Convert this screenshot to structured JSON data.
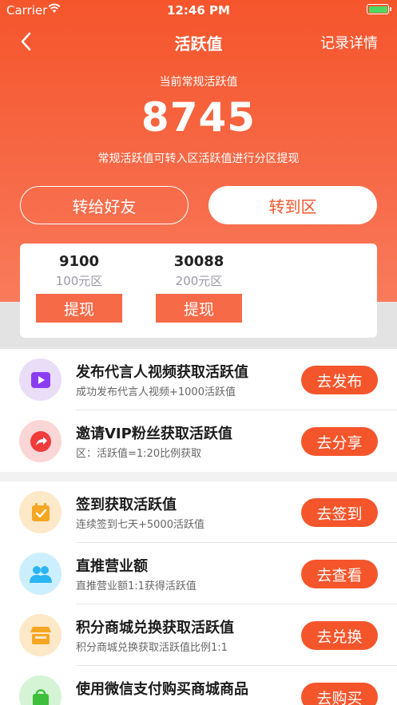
{
  "status_bar": {
    "carrier": "Carrier",
    "time": "12:46 PM"
  },
  "nav": {
    "title": "活跃值",
    "records": "记录详情"
  },
  "hero": {
    "label": "当前常规活跃值",
    "value": "8745",
    "note": "常规活跃值可转入区活跃值进行分区提现"
  },
  "actions": {
    "transfer_friend": "转给好友",
    "transfer_zone": "转到区"
  },
  "zones": [
    {
      "amount": "9100",
      "name": "100元区",
      "withdraw": "提现"
    },
    {
      "amount": "30088",
      "name": "200元区",
      "withdraw": "提现"
    }
  ],
  "tasks_group1": [
    {
      "title": "发布代言人视频获取活跃值",
      "subtitle": "成功发布代言人视频+1000活跃值",
      "action": "去发布",
      "icon": "video-play-icon",
      "icon_bg": "#e9ddf8",
      "icon_color": "#8a3df0"
    },
    {
      "title": "邀请VIP粉丝获取活跃值",
      "subtitle": "区：活跃值=1:20比例获取",
      "action": "去分享",
      "icon": "share-arrow-icon",
      "icon_bg": "#fbd6d6",
      "icon_color": "#f23b3b"
    }
  ],
  "tasks_group2": [
    {
      "title": "签到获取活跃值",
      "subtitle": "连续签到七天+5000活跃值",
      "action": "去签到",
      "icon": "calendar-check-icon",
      "icon_bg": "#fde8c8",
      "icon_color": "#f5a623"
    },
    {
      "title": "直推营业额",
      "subtitle": "直推营业额1:1获得活跃值",
      "action": "去查看",
      "icon": "users-icon",
      "icon_bg": "#ccefff",
      "icon_color": "#2bb5f2"
    },
    {
      "title": "积分商城兑换获取活跃值",
      "subtitle": "积分商城兑换获取活跃值比例1:1",
      "action": "去兑换",
      "icon": "store-icon",
      "icon_bg": "#fde8c8",
      "icon_color": "#f5a623"
    },
    {
      "title": "使用微信支付购买商城商品",
      "subtitle": "",
      "action": "去购买",
      "icon": "shopping-bag-icon",
      "icon_bg": "#d5f3d5",
      "icon_color": "#3cc03c"
    }
  ],
  "colors": {
    "primary": "#f5552b",
    "hero_end": "#f97b5b",
    "zone_button": "#f76a48",
    "battery": "#4cd964"
  }
}
